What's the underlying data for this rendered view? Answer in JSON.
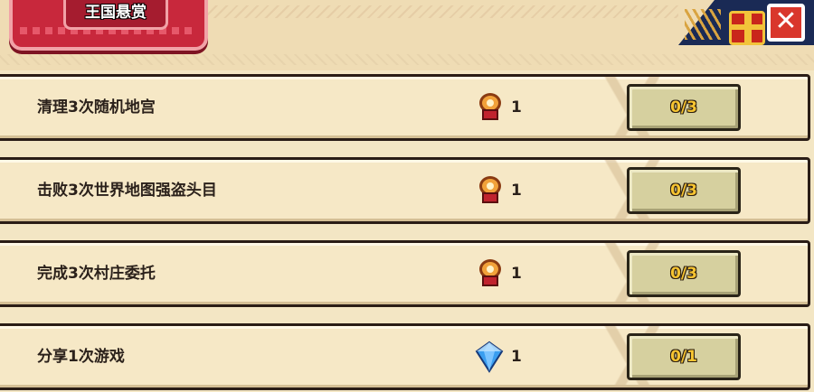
{
  "title": "王国悬赏",
  "close_label": "✕",
  "quests": [
    {
      "name": "清理3次随机地宫",
      "reward_icon": "medal-icon",
      "reward_amount": "1",
      "progress": "0/3"
    },
    {
      "name": "击败3次世界地图强盗头目",
      "reward_icon": "medal-icon",
      "reward_amount": "1",
      "progress": "0/3"
    },
    {
      "name": "完成3次村庄委托",
      "reward_icon": "medal-icon",
      "reward_amount": "1",
      "progress": "0/3"
    },
    {
      "name": "分享1次游戏",
      "reward_icon": "gem-icon",
      "reward_amount": "1",
      "progress": "0/1"
    }
  ],
  "colors": {
    "title_red": "#c8283c",
    "row_bg": "#f6e8c6",
    "progress_text": "#f6c431",
    "gem_blue": "#3a9ef0"
  }
}
